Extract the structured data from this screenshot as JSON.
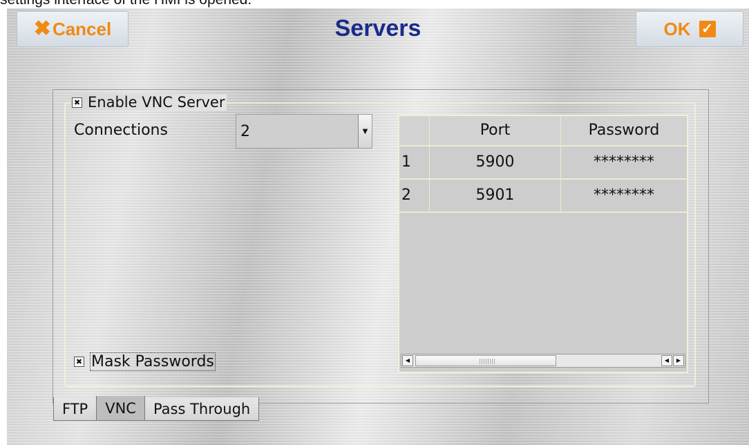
{
  "caption": "settings interface of the HMI is opened.",
  "header": {
    "cancel_label": "Cancel",
    "title": "Servers",
    "ok_label": "OK"
  },
  "vnc": {
    "enable_label": "Enable VNC Server",
    "enable_checked": true,
    "connections_label": "Connections",
    "connections_value": "2",
    "table": {
      "headers": [
        "",
        "Port",
        "Password"
      ],
      "rows": [
        {
          "index": "1",
          "port": "5900",
          "password": "********"
        },
        {
          "index": "2",
          "port": "5901",
          "password": "********"
        }
      ]
    },
    "mask_label": "Mask Passwords",
    "mask_checked": true
  },
  "tabs": [
    {
      "label": "FTP",
      "active": false
    },
    {
      "label": "VNC",
      "active": true
    },
    {
      "label": "Pass Through",
      "active": false
    }
  ],
  "colors": {
    "accent_orange": "#f08a14",
    "title_blue": "#1a2a8a"
  }
}
